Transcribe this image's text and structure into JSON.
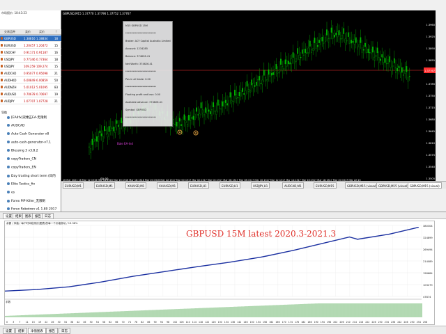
{
  "market_watch": {
    "title": "市场报价: 18:43:23",
    "columns": [
      "交易品种",
      "卖价",
      "买价",
      "!"
    ],
    "rows": [
      {
        "symbol": "GBPUSD",
        "bid": "1.38816",
        "ask": "1.38834",
        "spread": "18",
        "selected": true
      },
      {
        "symbol": "EURUSD",
        "bid": "1.20457",
        "ask": "1.20472",
        "spread": "15"
      },
      {
        "symbol": "USDCHF",
        "bid": "0.91171",
        "ask": "0.91187",
        "spread": "16"
      },
      {
        "symbol": "USDJPY",
        "bid": "0.77346",
        "ask": "0.77364",
        "spread": "18"
      },
      {
        "symbol": "USDJPY",
        "bid": "109.259",
        "ask": "109.274",
        "spread": "15"
      },
      {
        "symbol": "AUDCAD",
        "bid": "0.95077",
        "ask": "0.95098",
        "spread": "21"
      },
      {
        "symbol": "AUDHKD",
        "bid": "6.00849",
        "ask": "6.00859",
        "spread": "50"
      },
      {
        "symbol": "AUDNZH",
        "bid": "5.01012",
        "ask": "5.01095",
        "spread": "83"
      },
      {
        "symbol": "AUDUSD",
        "bid": "0.70678",
        "ask": "0.70697",
        "spread": "19"
      },
      {
        "symbol": "AUDJPY",
        "bid": "1.07707",
        "ask": "1.07728",
        "spread": "21"
      }
    ],
    "tabs": [
      "交易品种",
      "即时图"
    ]
  },
  "navigator": {
    "title": "导航",
    "items": [
      "[EA4fx]双乘正EA-无限制",
      "AUDCAD",
      "Auto Cash Generator v8",
      "auto-cash-generator-v7.1",
      "Blessing 3 v3.8.2",
      "copyTraders_CN",
      "copyTraders_EN",
      "Day trading short term (日内",
      "Elite Tactics_fix",
      "es",
      "Forex PIP Killer_无限制",
      "Forex Robotron v1 1.80 2017"
    ],
    "tabs": [
      "常用",
      "收藏夹"
    ]
  },
  "chart_window": {
    "title": "GBPUSD,M15  1.37770 1.37796 1.37752 1.37767",
    "price_labels": [
      "1.3960",
      "1.3925",
      "1.3890",
      "1.3855",
      "1.3820",
      "1.3785",
      "1.3750",
      "1.3715",
      "1.3680",
      "1.3645",
      "1.3610",
      "1.3575",
      "1.3540",
      "1.3505"
    ],
    "current_price": "1.37767",
    "time_labels": [
      "16 Mar 2021",
      "16 Mar 12:15",
      "16 Mar 14:15",
      "16 Mar 16:15",
      "16 Mar 18:15",
      "16 Mar 20:15",
      "16 Mar 22:15",
      "17 Mar 00:15",
      "17 Mar 02:15",
      "17 Mar 04:15",
      "17 Mar 06:15",
      "17 Mar 08:15",
      "17 Mar 10:15",
      "17 Mar 12:15",
      "17 Mar 14:15",
      "17 Mar 16:15",
      "17 Mar 18:15",
      "17 Mar 20:15",
      "17 Mar 22:15"
    ],
    "timer_text": "00:00",
    "ea_label": "Bale EA-Ind",
    "colors": {
      "bull": "#00c000",
      "bear": "#00c000",
      "bg": "#000000",
      "price_line": "#ff3030"
    }
  },
  "info_panel": {
    "lines": [
      "M15 GBPUSD 15M",
      "*************************",
      "Broker: ACY Capital Australia Limited",
      "Account: 1234285",
      "Balance: 374626.41",
      "Net Worth: 374626.41",
      "*************************",
      "Pos in all trade: 0.00",
      "*************************",
      "Floating profit and loss: 0.00",
      "Available advance: 374626.41",
      "Symbol: GBPUSD",
      "*************************"
    ]
  },
  "chart_tabs": [
    "EURUSD,M1",
    "EURUSD,M1",
    "XAUUSD,M1",
    "XAUUSD,M1",
    "EURUSD,H1",
    "EURUSD,H1",
    "USDJPY,H1",
    "AUDCAD,M1",
    "EURUSD,M15",
    "GBPUSD,M15 (visual)",
    "GBPUSD,M15 (visual)",
    "GBPUSD,M15 (visual)"
  ],
  "tester": {
    "top_tabs": [
      "设置",
      "结果",
      "图表",
      "报告",
      "日志"
    ],
    "graph_caption": "余额 / 净值 / 每个时间段测试(图表)的每一个价格变动 / 13.38%",
    "overlay_title": "GBPUSD 15M latest 2020.3-2021.3",
    "y_labels": [
      "380304",
      "324899",
      "269494",
      "214089",
      "158684",
      "103279",
      "47874"
    ],
    "x_labels": [
      "0",
      "3",
      "7",
      "11",
      "15",
      "19",
      "22",
      "26",
      "30",
      "34",
      "38",
      "42",
      "46",
      "50",
      "54",
      "58",
      "62",
      "66",
      "70",
      "74",
      "78",
      "82",
      "86",
      "90",
      "94",
      "98",
      "102",
      "106",
      "110",
      "114",
      "118",
      "122",
      "126",
      "130",
      "134",
      "138",
      "142",
      "146",
      "150",
      "154",
      "158",
      "162",
      "166",
      "170",
      "174",
      "178",
      "182",
      "186",
      "190",
      "194",
      "198",
      "202",
      "206",
      "210",
      "214",
      "218",
      "222",
      "226",
      "230",
      "234",
      "238",
      "242",
      "246",
      "250",
      "254",
      "258"
    ],
    "volume_label": "手数",
    "bottom_tabs": [
      "设置",
      "结果",
      "净值图表",
      "报告",
      "日志"
    ],
    "active_bottom_tab": 2,
    "colors": {
      "balance": "#1a2fa0",
      "equity": "#1a2fa0",
      "volume": "#40a040",
      "title": "#e0302a"
    }
  },
  "chart_data": {
    "type": "line",
    "title": "GBPUSD 15M latest 2020.3-2021.3",
    "series": [
      {
        "name": "余额",
        "x": [
          0,
          20,
          40,
          60,
          80,
          100,
          120,
          140,
          160,
          180,
          200,
          215,
          220,
          240,
          258
        ],
        "values": [
          47874,
          56000,
          70000,
          95000,
          125000,
          150000,
          175000,
          198000,
          225000,
          260000,
          300000,
          330000,
          318000,
          345000,
          380304
        ]
      }
    ],
    "ylim": [
      20000,
      390000
    ],
    "xlim": [
      0,
      260
    ],
    "grid": true
  }
}
